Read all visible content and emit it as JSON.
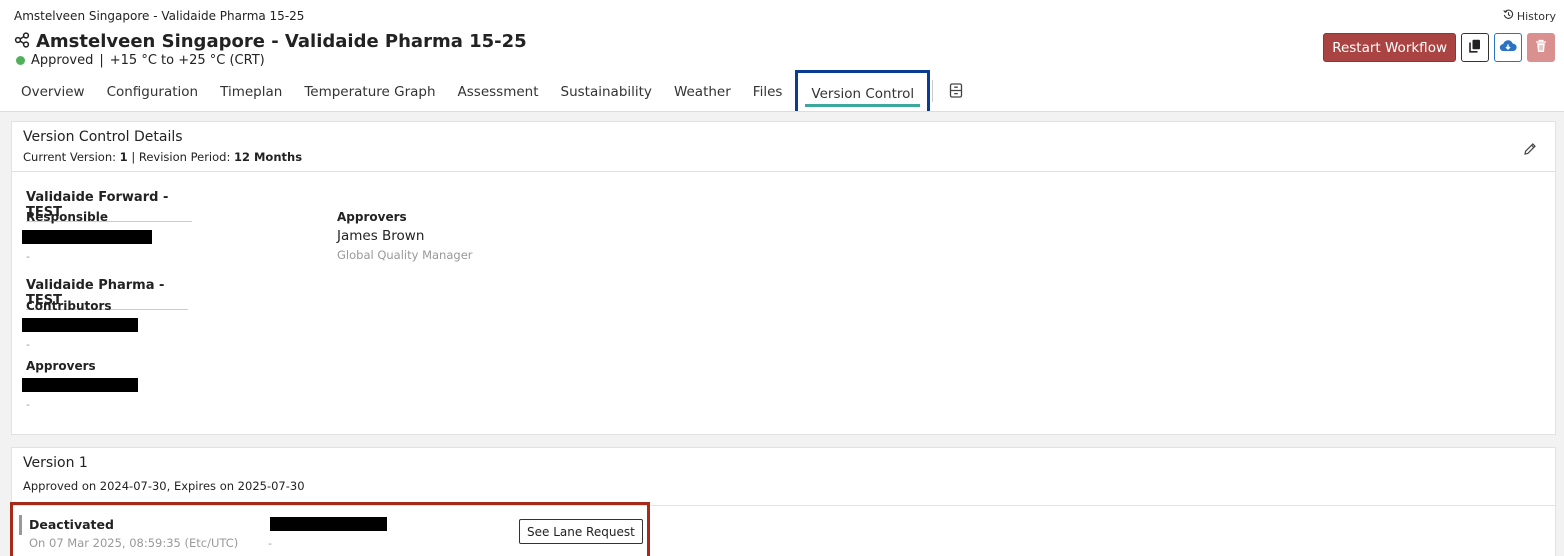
{
  "header": {
    "breadcrumb": "Amstelveen Singapore - Validaide Pharma 15-25",
    "history_label": "History",
    "title": "Amstelveen Singapore - Validaide Pharma 15-25",
    "status": "Approved",
    "separator": "|",
    "temperature": "+15 °C to +25 °C (CRT)",
    "restart_label": "Restart Workflow",
    "colors": {
      "status_dot": "#52b05a",
      "danger": "#a94442",
      "primary": "#2b73c2"
    }
  },
  "tabs": [
    {
      "label": "Overview"
    },
    {
      "label": "Configuration"
    },
    {
      "label": "Timeplan"
    },
    {
      "label": "Temperature Graph"
    },
    {
      "label": "Assessment"
    },
    {
      "label": "Sustainability"
    },
    {
      "label": "Weather"
    },
    {
      "label": "Files"
    },
    {
      "label": "Version Control",
      "active": true
    }
  ],
  "details": {
    "title": "Version Control Details",
    "current_version_label": "Current Version:",
    "current_version": "1",
    "separator": "|",
    "revision_label": "Revision Period:",
    "revision_period": "12 Months",
    "org1": {
      "name": "Validaide Forward - TEST",
      "responsible_label": "Responsible",
      "responsible_dash": "-",
      "approvers_label": "Approvers",
      "approver_name": "James Brown",
      "approver_role": "Global Quality Manager"
    },
    "org2": {
      "name": "Validaide Pharma - TEST",
      "contributors_label": "Contributors",
      "contributors_dash": "-",
      "approvers_label": "Approvers",
      "approvers_dash": "-"
    }
  },
  "version": {
    "title": "Version 1",
    "approved_text": "Approved on 2024-07-30, Expires on 2025-07-30",
    "state": "Deactivated",
    "state_date": "On 07 Mar 2025, 08:59:35 (Etc/UTC)",
    "user_dash": "-",
    "see_lane_label": "See Lane Request"
  }
}
